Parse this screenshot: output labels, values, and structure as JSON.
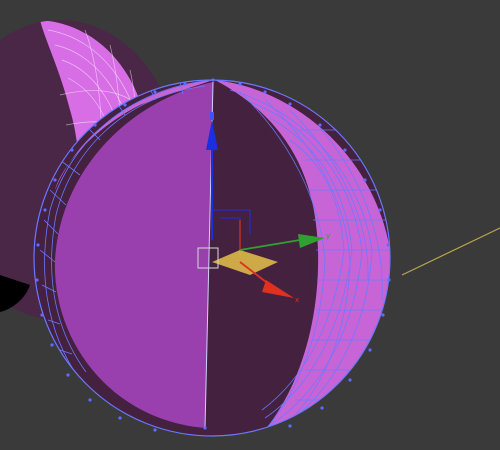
{
  "viewport": {
    "background": "#3a3a3a",
    "mode": "perspective-viewport"
  },
  "objects": [
    {
      "name": "background-sphere",
      "type": "sphere",
      "state": "unselected",
      "colors": {
        "lit": "#d86ee6",
        "shadow": "#4a2746",
        "wire": "#ffffff"
      }
    },
    {
      "name": "selected-sphere",
      "type": "sphere",
      "state": "selected-editable-poly",
      "colors": {
        "lit": "#c865d6",
        "front_face": "#9a3fae",
        "inner_face": "#43213f",
        "wire": "#6a78ff",
        "vertex": "#5f6bff"
      }
    }
  ],
  "gizmo": {
    "type": "move-gizmo",
    "axes": [
      {
        "axis": "x",
        "label": "x",
        "color": "#e03020"
      },
      {
        "axis": "y",
        "label": "y",
        "color": "#30a030"
      },
      {
        "axis": "z",
        "label": "",
        "color": "#1a2fe0"
      }
    ],
    "plane_color": "#e6c14a",
    "pivot_box_color": "#d9d9d9"
  },
  "line": {
    "name": "target-line",
    "color": "#b8a84a"
  }
}
